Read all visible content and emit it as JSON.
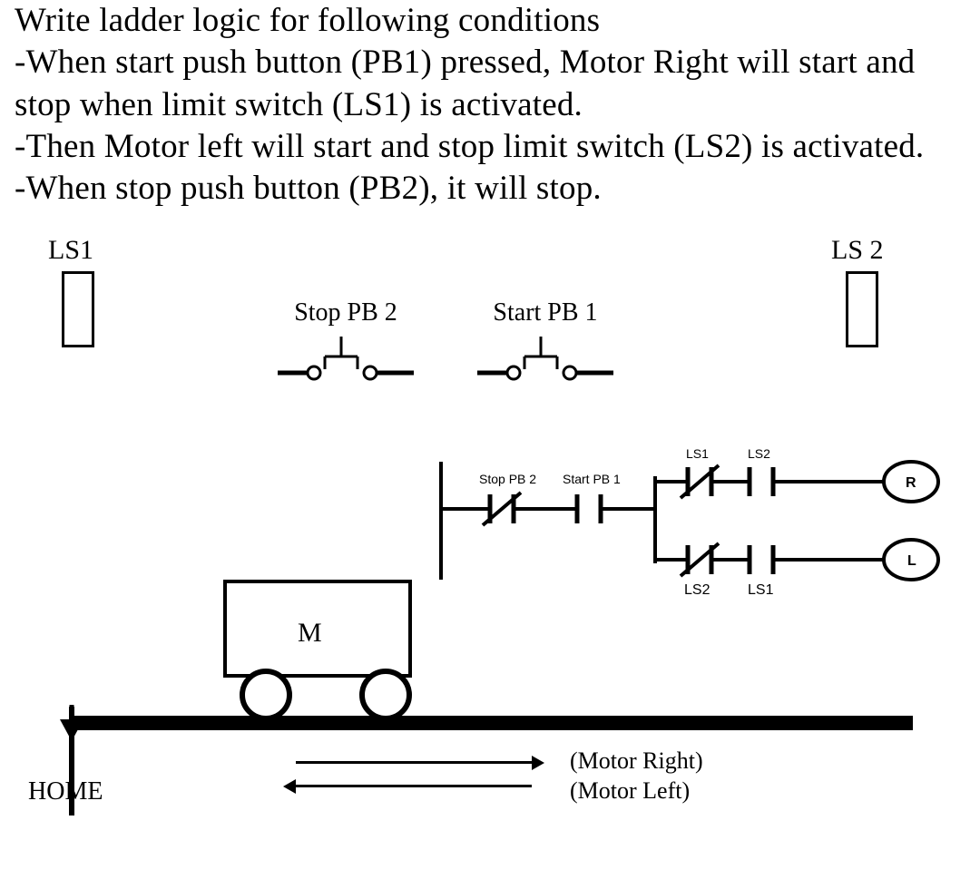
{
  "problem": {
    "title": "Write  ladder logic for following conditions",
    "line1": "-When start push button (PB1) pressed, Motor Right will start and stop when limit switch (LS1) is activated.",
    "line2": "-Then Motor left will start and stop limit switch (LS2) is activated.",
    "line3": "-When stop push button (PB2), it will stop."
  },
  "labels": {
    "ls1": "LS1",
    "ls2": "LS  2",
    "stop_pb": "Stop PB 2",
    "start_pb": "Start PB 1",
    "motor_letter": "M",
    "home": "HOME",
    "motor_right": "(Motor Right)",
    "motor_left": "(Motor Left)"
  },
  "ladder": {
    "stop": "Stop PB 2",
    "start": "Start PB 1",
    "top_ls1": "LS1",
    "top_ls2": "LS2",
    "bot_ls2": "LS2",
    "bot_ls1": "LS1",
    "coil_r": "R",
    "coil_l": "L"
  }
}
